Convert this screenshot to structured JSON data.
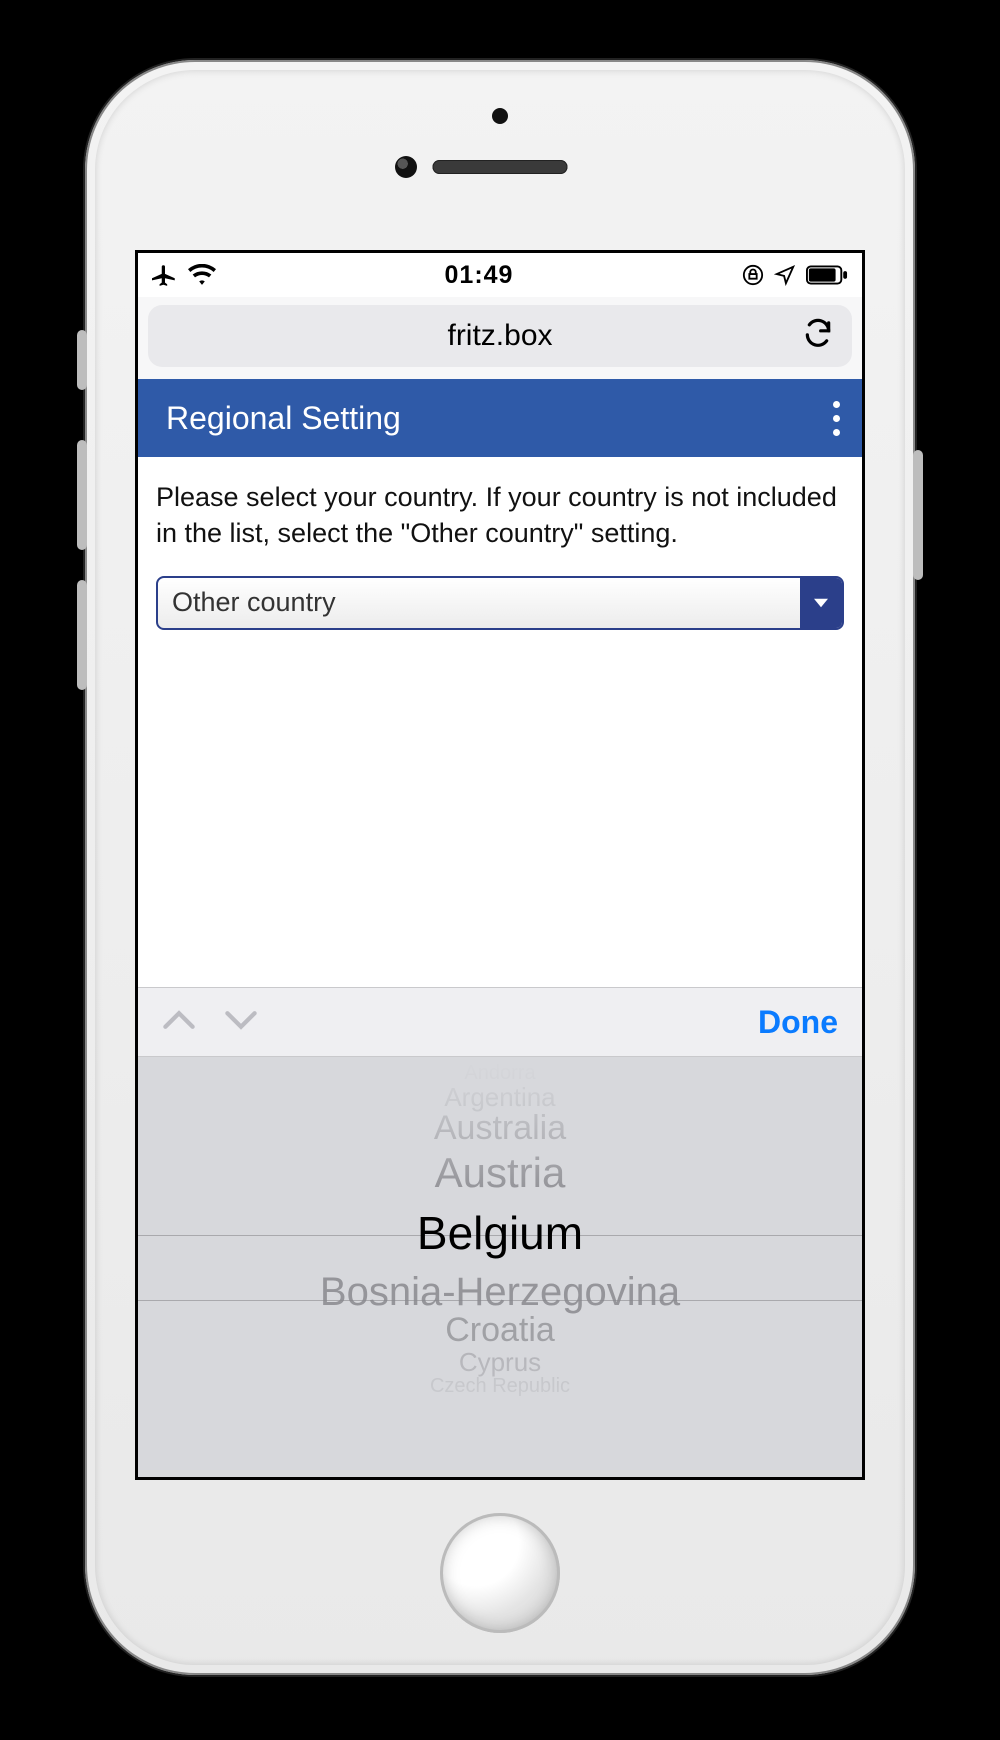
{
  "status": {
    "time": "01:49"
  },
  "browser": {
    "address": "fritz.box"
  },
  "header": {
    "title": "Regional Setting"
  },
  "content": {
    "prompt": "Please select your country. If your country is not included in the list, select the \"Other country\" setting.",
    "select_value": "Other country"
  },
  "accessory": {
    "done": "Done"
  },
  "picker": {
    "selected": "Belgium",
    "items": [
      "Andorra",
      "Argentina",
      "Australia",
      "Austria",
      "Belgium",
      "Bosnia-Herzegovina",
      "Croatia",
      "Cyprus",
      "Czech Republic"
    ]
  }
}
